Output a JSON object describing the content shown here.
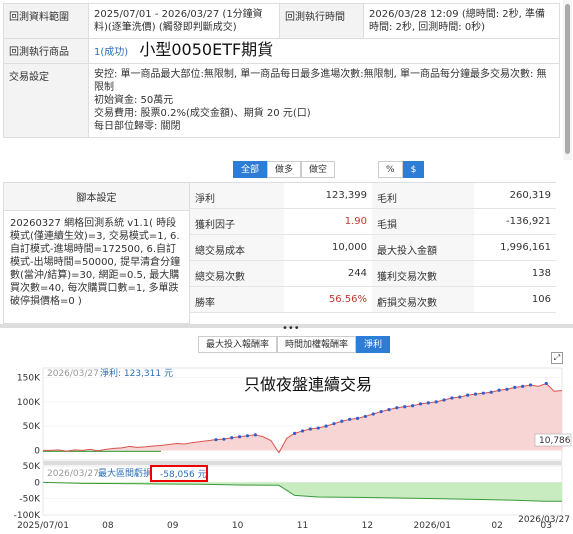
{
  "info": {
    "range_label": "回測資料範圍",
    "range_value": "2025/07/01 - 2026/03/27 (1分鐘資料)(逐筆洗價) (觸發即判斷成交)",
    "exec_time_label": "回測執行時間",
    "exec_time_value": "2026/03/28 12:09 (總時間: 2秒, 準備時間: 2秒, 回測時間: 0秒)",
    "product_label": "回測執行商品",
    "product_status": "1(成功)",
    "product_name": "小型0050ETF期貨",
    "trade_label": "交易設定",
    "trade_line1": "安控: 單一商品最大部位:無限制, 單一商品每日最多進場次數:無限制, 單一商品每分鐘最多交易次數: 無限制",
    "trade_line2": "初始資金: 50萬元",
    "trade_line3": "交易費用: 股票0.2%(成交金額)、期貨 20 元(口)",
    "trade_line4": "每日部位歸零: 關閉"
  },
  "filter_buttons": {
    "all": "全部",
    "long": "做多",
    "short": "做空"
  },
  "unit_buttons": {
    "pct": "%",
    "dollar": "$"
  },
  "script": {
    "header": "腳本設定",
    "body": "20260327 網格回測系統 v1.1( 時段模式(僅連續生效)=3, 交易模式=1, 6.自訂模式-進場時間=172500, 6.自訂模式-出場時間=50000, 提早清倉分鐘數(當沖/結算)=30, 網距=0.5, 最大購買次數=40, 每次購買口數=1, 多單跌破停損價格=0 )"
  },
  "stats": [
    {
      "l1": "淨利",
      "v1": "123,399",
      "l2": "毛利",
      "v2": "260,319"
    },
    {
      "l1": "獲利因子",
      "v1": "1.90",
      "l2": "毛損",
      "v2": "-136,921"
    },
    {
      "l1": "總交易成本",
      "v1": "10,000",
      "l2": "最大投入金額",
      "v2": "1,996,161"
    },
    {
      "l1": "總交易次數",
      "v1": "244",
      "l2": "獲利交易次數",
      "v2": "138"
    },
    {
      "l1": "勝率",
      "v1": "56.56%",
      "l2": "虧損交易次數",
      "v2": "106"
    }
  ],
  "chart_tabs": {
    "t1": "最大投入報酬率",
    "t2": "時間加權報酬率",
    "t3": "淨利"
  },
  "splitter_dots": "•••",
  "expand_icon": "⤢",
  "chart_data": {
    "type": "area",
    "top": {
      "date_label": "2026/03/27",
      "series_label": "淨利: 123,311 元",
      "annotation": "只做夜盤連續交易",
      "end_value_label": "10,786",
      "yticks": [
        "150K",
        "100K",
        "50K",
        "0"
      ],
      "ylim": [
        -20000,
        170000
      ],
      "x": [
        0,
        4,
        8,
        12,
        16,
        20,
        24,
        28,
        32,
        36,
        40,
        44,
        48,
        52,
        56,
        60,
        64,
        68,
        72,
        76,
        80,
        84,
        88,
        92,
        96,
        100,
        104,
        108,
        112,
        116,
        120,
        124,
        128,
        132,
        136,
        140,
        144,
        148,
        152,
        156,
        160,
        164,
        168,
        172,
        176,
        180,
        184,
        188,
        192,
        196,
        200,
        204,
        208,
        212,
        216,
        220,
        224,
        228,
        232,
        236,
        240,
        244,
        248,
        252,
        256,
        260,
        264
      ],
      "values": [
        0,
        0,
        1000,
        -2000,
        1000,
        0,
        2000,
        -1000,
        2000,
        4000,
        5000,
        8000,
        6000,
        7000,
        9000,
        10000,
        12000,
        14000,
        13000,
        16000,
        18000,
        20000,
        22000,
        23000,
        26000,
        28000,
        30000,
        32000,
        28000,
        20000,
        -5000,
        25000,
        35000,
        40000,
        44000,
        46000,
        50000,
        55000,
        60000,
        64000,
        66000,
        70000,
        75000,
        80000,
        84000,
        88000,
        90000,
        92000,
        96000,
        98000,
        100000,
        104000,
        108000,
        110000,
        114000,
        116000,
        118000,
        120000,
        124000,
        126000,
        130000,
        132000,
        135000,
        132000,
        138000,
        122000,
        123311
      ]
    },
    "bottom": {
      "date_label": "2026/03/27",
      "series_label": "最大區間虧損",
      "value_label": "-58,056 元",
      "yticks": [
        "50K",
        "0",
        "-50K",
        "-100K"
      ],
      "ylim": [
        -100000,
        50000
      ],
      "x": [
        0,
        20,
        40,
        60,
        80,
        100,
        120,
        128,
        140,
        160,
        180,
        200,
        220,
        240,
        255,
        264
      ],
      "values": [
        0,
        -3000,
        -4000,
        -5000,
        -6000,
        -8000,
        -9000,
        -40000,
        -45000,
        -46000,
        -48000,
        -50000,
        -52000,
        -55000,
        -58000,
        -58056
      ]
    },
    "xticks": [
      "2025/07/01",
      "08",
      "09",
      "10",
      "11",
      "12",
      "2026/01",
      "02",
      "03",
      "2026/03/27"
    ]
  }
}
